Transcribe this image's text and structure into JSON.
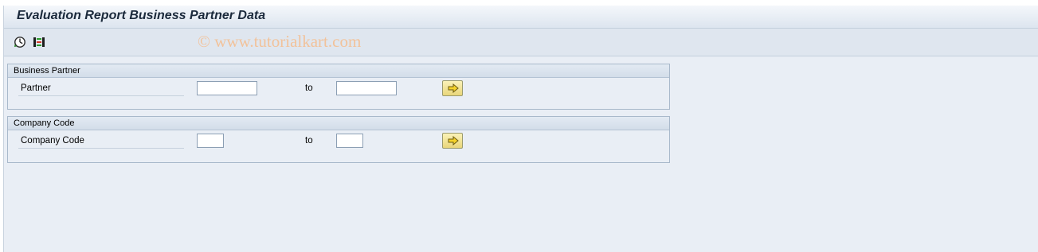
{
  "window": {
    "title": "Evaluation Report Business Partner Data"
  },
  "toolbar": {
    "watermark": "© www.tutorialkart.com",
    "icons": [
      "execute-icon",
      "selection-options-icon"
    ]
  },
  "groups": [
    {
      "title": "Business Partner",
      "field_label": "Partner",
      "from_value": "",
      "to_label": "to",
      "to_value": "",
      "multi_button_icon": "multiple-selection-arrow-icon"
    },
    {
      "title": "Company Code",
      "field_label": "Company Code",
      "from_value": "",
      "to_label": "to",
      "to_value": "",
      "multi_button_icon": "multiple-selection-arrow-icon"
    }
  ],
  "colors": {
    "background": "#e9eef5",
    "group_border": "#a9b9cb",
    "button_yellow": "#f3e39a",
    "watermark": "#f2c29a"
  }
}
